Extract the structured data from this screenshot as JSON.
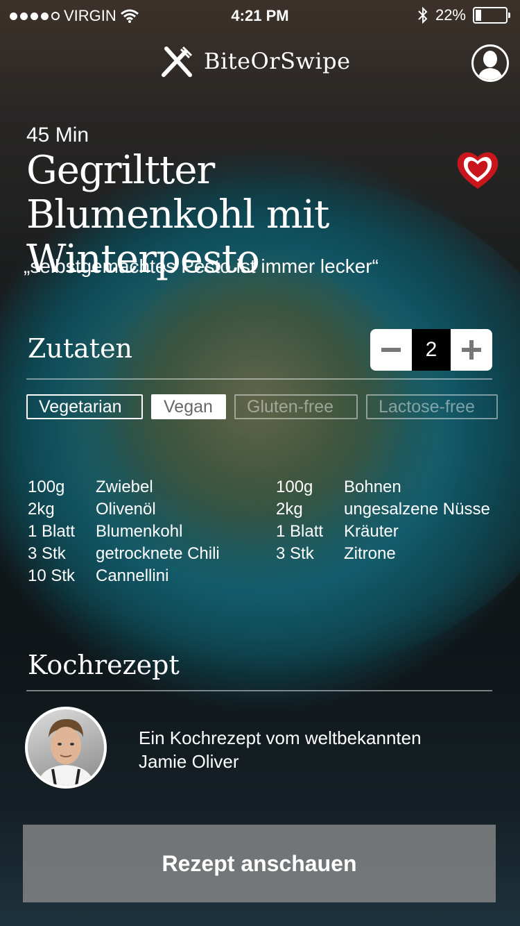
{
  "status_bar": {
    "carrier": "VIRGIN",
    "time": "4:21 PM",
    "battery": "22%",
    "battery_level": 0.22,
    "signal_dots_filled": 4
  },
  "header": {
    "app_name": "BiteOrSwipe",
    "logo_icon": "fork-knife-cross-icon",
    "profile_icon": "user-avatar-icon"
  },
  "recipe": {
    "duration": "45 Min",
    "title": "Gegriltter Blumenkohl mit Winterpesto",
    "quote": "„selbstgemachtes Pesto ist immer lecker“",
    "favorite_icon": "heart-icon",
    "accent_color": "#c9161c"
  },
  "ingredients_section": {
    "heading": "Zutaten",
    "servings": "2",
    "minus_icon": "minus-icon",
    "plus_icon": "plus-icon",
    "tags": [
      {
        "label": "Vegetarian",
        "state": "outline"
      },
      {
        "label": "Vegan",
        "state": "filled"
      },
      {
        "label": "Gluten-free",
        "state": "disabled"
      },
      {
        "label": "Lactose-free",
        "state": "disabled"
      }
    ],
    "left_column": [
      {
        "amount": "100g",
        "name": "Zwiebel"
      },
      {
        "amount": "2kg",
        "name": "Olivenöl"
      },
      {
        "amount": "1 Blatt",
        "name": "Blumenkohl"
      },
      {
        "amount": "3 Stk",
        "name": "getrocknete Chili"
      },
      {
        "amount": "10 Stk",
        "name": "Cannellini"
      }
    ],
    "right_column": [
      {
        "amount": "100g",
        "name": "Bohnen"
      },
      {
        "amount": "2kg",
        "name": "ungesalzene Nüsse"
      },
      {
        "amount": "1 Blatt",
        "name": "Kräuter"
      },
      {
        "amount": "3 Stk",
        "name": "Zitrone"
      }
    ]
  },
  "recipe_section": {
    "heading": "Kochrezept",
    "chef_text_line1": "Ein Kochrezept vom weltbekannten",
    "chef_text_line2": "Jamie Oliver"
  },
  "cta": {
    "label": "Rezept anschauen"
  }
}
